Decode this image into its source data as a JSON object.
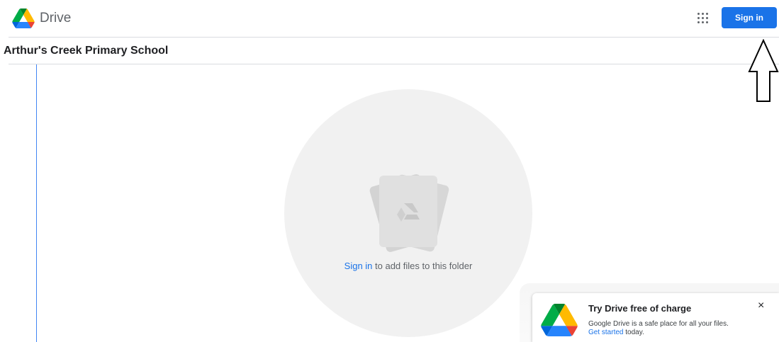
{
  "header": {
    "brand": "Drive",
    "apps_icon": "apps-grid-icon",
    "signin_label": "Sign in"
  },
  "folder": {
    "title": "Arthur's Creek Primary School"
  },
  "empty_state": {
    "link_text": "Sign in",
    "message": " to add files to this folder"
  },
  "promo": {
    "title": "Try Drive free of charge",
    "body": "Google Drive is a safe place for all your files.",
    "link_text": "Get started",
    "link_suffix": " today.",
    "close_label": "×"
  },
  "colors": {
    "accent": "#1a73e8",
    "drive_green": "#0f9d58",
    "drive_yellow": "#ffcd40",
    "drive_blue": "#4285f4"
  }
}
